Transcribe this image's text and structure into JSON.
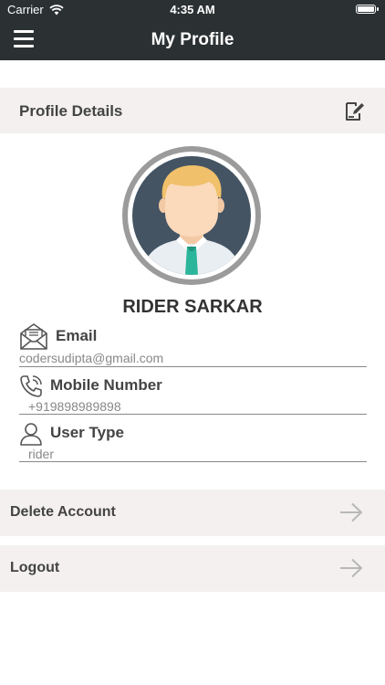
{
  "status_bar": {
    "carrier": "Carrier",
    "time": "4:35 AM",
    "battery_level": 1.0
  },
  "nav": {
    "title": "My Profile",
    "menu_icon": "hamburger-icon"
  },
  "profile_details": {
    "label": "Profile Details",
    "edit_icon": "edit-icon"
  },
  "user": {
    "name": "RIDER SARKAR"
  },
  "fields": [
    {
      "icon": "envelope-icon",
      "label": "Email",
      "value": "codersudipta@gmail.com"
    },
    {
      "icon": "phone-icon",
      "label": "Mobile Number",
      "value": "+919898989898"
    },
    {
      "icon": "user-icon",
      "label": "User Type",
      "value": "rider"
    }
  ],
  "actions": {
    "delete_account": "Delete Account",
    "logout": "Logout"
  },
  "colors": {
    "header": "#2b3133",
    "section_bg": "#f3f0ef",
    "accent_tie": "#2bb59a"
  }
}
